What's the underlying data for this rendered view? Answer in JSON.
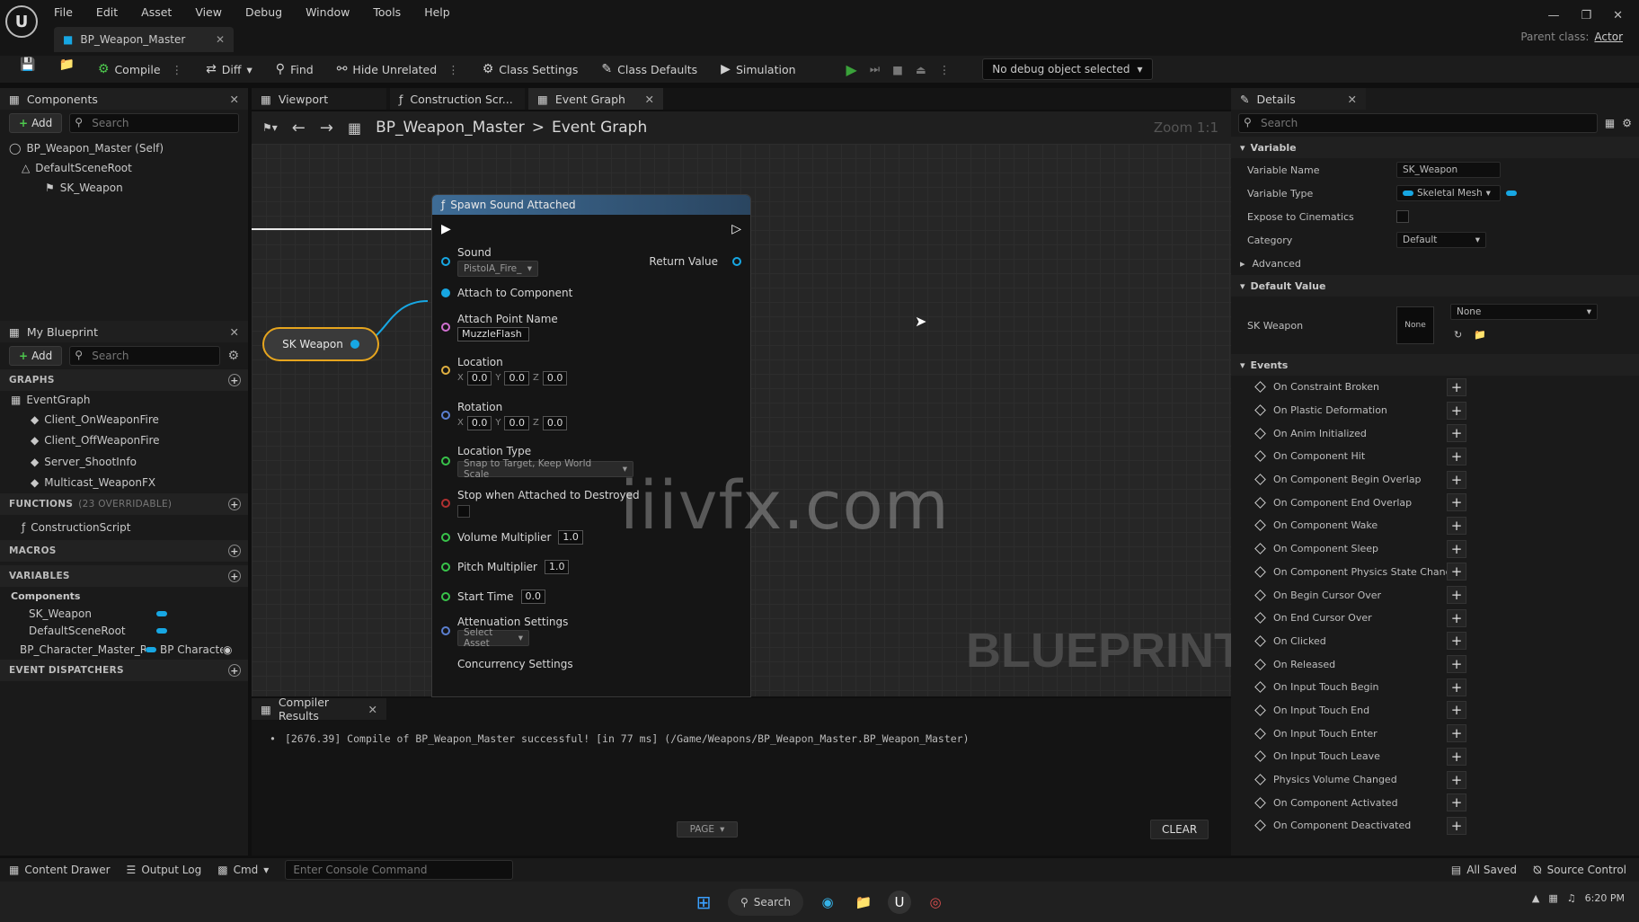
{
  "menu": [
    "File",
    "Edit",
    "Asset",
    "View",
    "Debug",
    "Window",
    "Tools",
    "Help"
  ],
  "doc_tab": "BP_Weapon_Master",
  "parent_class_label": "Parent class:",
  "parent_class_value": "Actor",
  "toolbar": {
    "compile": "Compile",
    "diff": "Diff",
    "find": "Find",
    "hide_unrelated": "Hide Unrelated",
    "class_settings": "Class Settings",
    "class_defaults": "Class Defaults",
    "simulation": "Simulation",
    "debug_object": "No debug object selected"
  },
  "components": {
    "tab": "Components",
    "add": "Add",
    "search_placeholder": "Search",
    "tree": [
      "BP_Weapon_Master (Self)",
      "DefaultSceneRoot",
      "SK_Weapon"
    ]
  },
  "my_blueprint": {
    "tab": "My Blueprint",
    "add": "Add",
    "search_placeholder": "Search",
    "graphs_header": "GRAPHS",
    "event_graph": "EventGraph",
    "events": [
      "Client_OnWeaponFire",
      "Client_OffWeaponFire",
      "Server_ShootInfo",
      "Multicast_WeaponFX"
    ],
    "functions_header": "FUNCTIONS",
    "functions_count": "(23 OVERRIDABLE)",
    "functions": [
      "ConstructionScript"
    ],
    "macros_header": "MACROS",
    "variables_header": "VARIABLES",
    "components_group": "Components",
    "variables": [
      "SK_Weapon",
      "DefaultSceneRoot"
    ],
    "char_var": "BP_Character_Master_R",
    "char_var_type": "BP Characte",
    "dispatchers_header": "EVENT DISPATCHERS"
  },
  "graph_tabs": [
    "Viewport",
    "Construction Scr...",
    "Event Graph"
  ],
  "breadcrumb": {
    "root": "BP_Weapon_Master",
    "sep": ">",
    "current": "Event Graph"
  },
  "zoom": "Zoom 1:1",
  "node": {
    "title": "Spawn Sound Attached",
    "sound_label": "Sound",
    "sound_value": "PistolA_Fire_Cu",
    "return_value": "Return Value",
    "attach_component": "Attach to Component",
    "attach_point_label": "Attach Point Name",
    "attach_point_value": "MuzzleFlash",
    "location_label": "Location",
    "location": {
      "x": "0.0",
      "y": "0.0",
      "z": "0.0"
    },
    "rotation_label": "Rotation",
    "rotation": {
      "x": "0.0",
      "y": "0.0",
      "z": "0.0"
    },
    "axis": {
      "x": "X",
      "y": "Y",
      "z": "Z"
    },
    "location_type_label": "Location Type",
    "location_type_value": "Snap to Target, Keep World Scale",
    "stop_destroyed": "Stop when Attached to Destroyed",
    "volume_label": "Volume Multiplier",
    "volume_value": "1.0",
    "pitch_label": "Pitch Multiplier",
    "pitch_value": "1.0",
    "start_label": "Start Time",
    "start_value": "0.0",
    "attenuation_label": "Attenuation Settings",
    "attenuation_value": "Select Asset",
    "concurrency_label": "Concurrency Settings"
  },
  "sk_node": "SK Weapon",
  "watermark": "iiivfx.com",
  "blueprint_mark": "BLUEPRINT",
  "compiler": {
    "tab": "Compiler Results",
    "message": "[2676.39] Compile of BP_Weapon_Master successful! [in 77 ms] (/Game/Weapons/BP_Weapon_Master.BP_Weapon_Master)",
    "page": "PAGE",
    "clear": "CLEAR"
  },
  "details": {
    "tab": "Details",
    "search_placeholder": "Search",
    "variable_header": "Variable",
    "variable_name_label": "Variable Name",
    "variable_name_value": "SK_Weapon",
    "variable_type_label": "Variable Type",
    "variable_type_value": "Skeletal Mesh",
    "expose_label": "Expose to Cinematics",
    "category_label": "Category",
    "category_value": "Default",
    "advanced": "Advanced",
    "default_value_header": "Default Value",
    "sk_weapon_label": "SK Weapon",
    "thumb": "None",
    "none_value": "None",
    "events_header": "Events",
    "events": [
      "On Constraint Broken",
      "On Plastic Deformation",
      "On Anim Initialized",
      "On Component Hit",
      "On Component Begin Overlap",
      "On Component End Overlap",
      "On Component Wake",
      "On Component Sleep",
      "On Component Physics State Changed",
      "On Begin Cursor Over",
      "On End Cursor Over",
      "On Clicked",
      "On Released",
      "On Input Touch Begin",
      "On Input Touch End",
      "On Input Touch Enter",
      "On Input Touch Leave",
      "Physics Volume Changed",
      "On Component Activated",
      "On Component Deactivated"
    ]
  },
  "status": {
    "content_drawer": "Content Drawer",
    "output_log": "Output Log",
    "cmd": "Cmd",
    "console_placeholder": "Enter Console Command",
    "all_saved": "All Saved",
    "source_control": "Source Control"
  },
  "taskbar": {
    "search": "Search",
    "time": "6:20 PM"
  },
  "colors": {
    "accent_blue": "#17a7e3",
    "node_header": "#3e6c96",
    "selected_orange": "#e6a51e",
    "play_green": "#3aa23a"
  }
}
